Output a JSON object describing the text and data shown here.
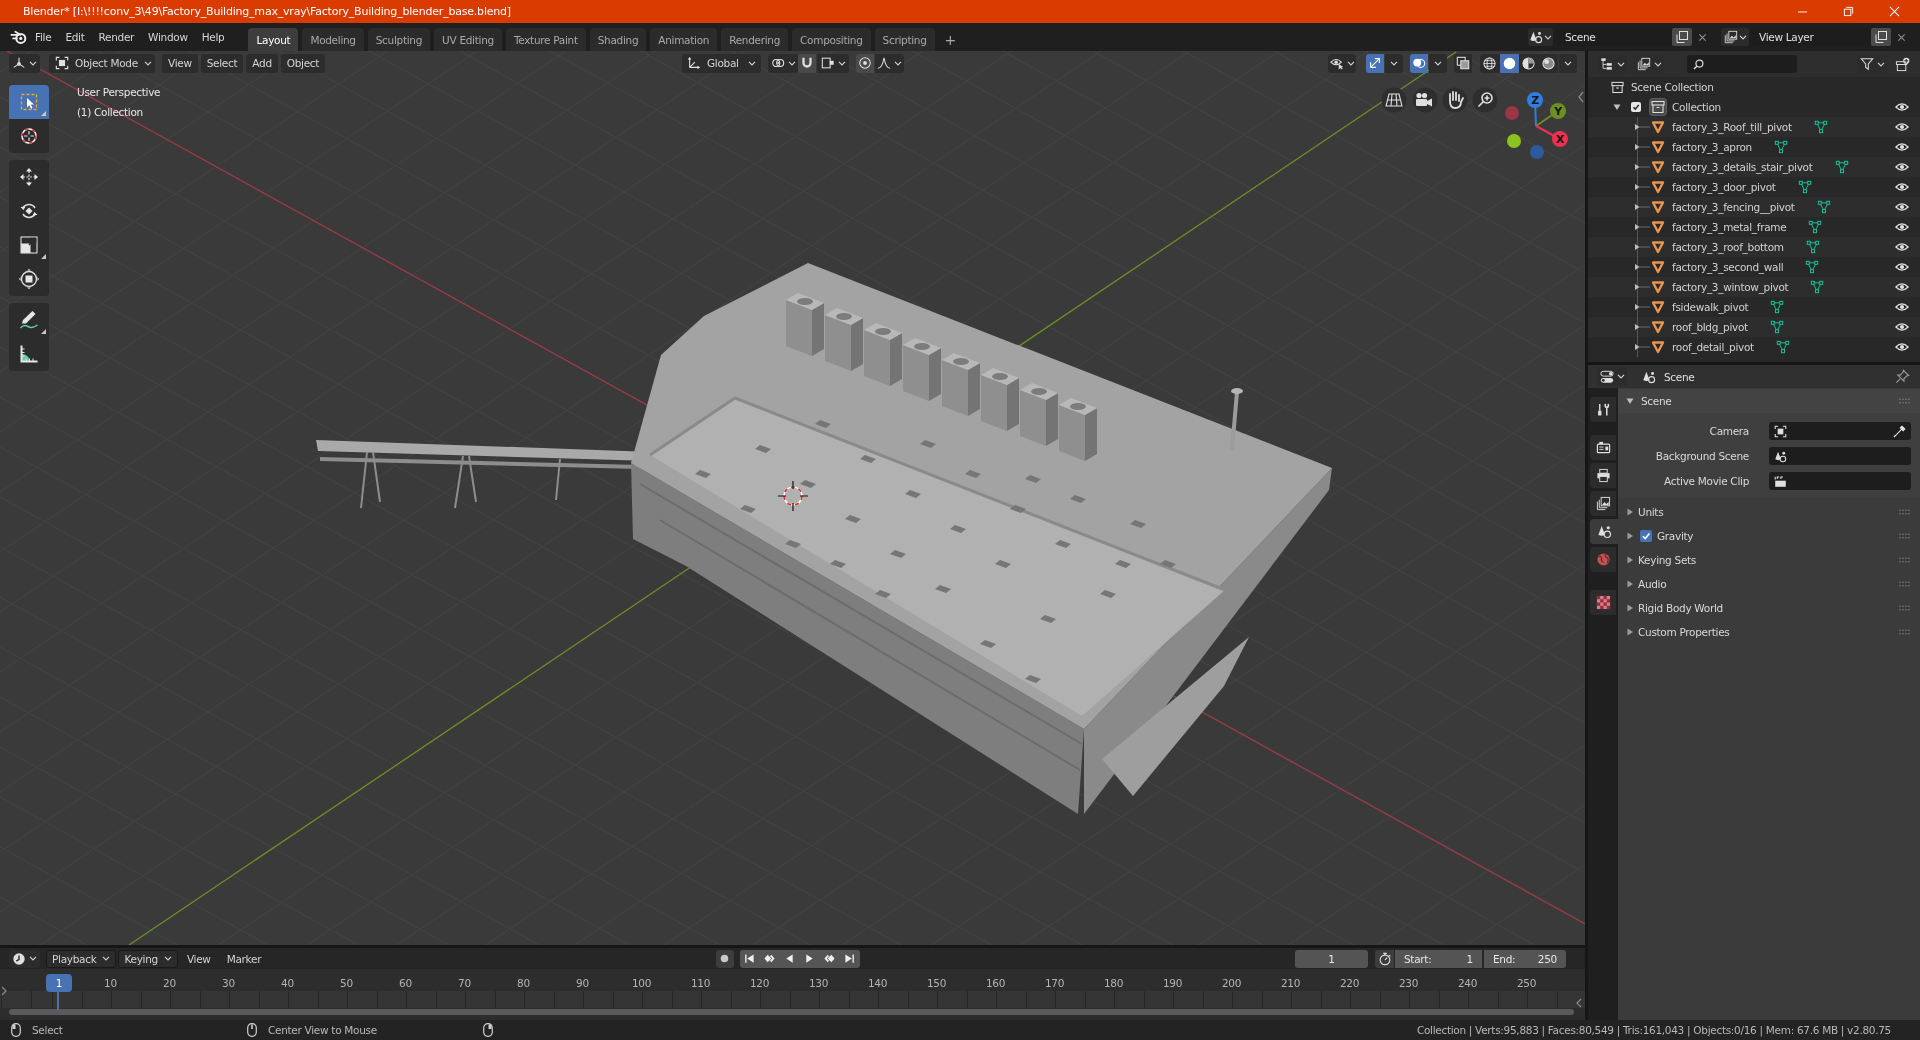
{
  "title_bar": {
    "title": "Blender* [I:\\!!!!conv_3\\49\\Factory_Building_max_vray\\Factory_Building_blender_base.blend]"
  },
  "top_bar": {
    "menus": [
      "File",
      "Edit",
      "Render",
      "Window",
      "Help"
    ],
    "workspaces": [
      {
        "label": "Layout",
        "selected": true
      },
      {
        "label": "Modeling",
        "selected": false
      },
      {
        "label": "Sculpting",
        "selected": false
      },
      {
        "label": "UV Editing",
        "selected": false
      },
      {
        "label": "Texture Paint",
        "selected": false
      },
      {
        "label": "Shading",
        "selected": false
      },
      {
        "label": "Animation",
        "selected": false
      },
      {
        "label": "Rendering",
        "selected": false
      },
      {
        "label": "Compositing",
        "selected": false
      },
      {
        "label": "Scripting",
        "selected": false
      }
    ],
    "add_workspace": "+",
    "scene": "Scene",
    "view_layer": "View Layer"
  },
  "viewport": {
    "header": {
      "mode": "Object Mode",
      "menus": [
        "View",
        "Select",
        "Add",
        "Object"
      ],
      "orientation": "Global",
      "gizmos_on": true,
      "overlays_on": true,
      "xray_on": false,
      "shading": [
        {
          "kind": "wireframe",
          "selected": false
        },
        {
          "kind": "solid",
          "selected": true
        },
        {
          "kind": "material",
          "selected": false
        },
        {
          "kind": "rendered",
          "selected": false
        }
      ]
    },
    "view_name": "User Perspective",
    "collection_info": "(1) Collection",
    "tools": [
      {
        "kind": "select_box",
        "selected": true
      },
      {
        "kind": "cursor",
        "selected": false
      },
      {
        "kind": "move",
        "selected": false
      },
      {
        "kind": "rotate",
        "selected": false
      },
      {
        "kind": "scale",
        "selected": false
      },
      {
        "kind": "transform",
        "selected": false
      },
      {
        "kind": "annotate",
        "selected": false
      },
      {
        "kind": "measure",
        "selected": false
      }
    ],
    "gizmo_axes": [
      {
        "label": "Z",
        "color": "#2f7fe0"
      },
      {
        "label": "Y",
        "color": "#6b8f21"
      },
      {
        "label": "X",
        "color": "#f0304f"
      }
    ]
  },
  "outliner": {
    "root": "Scene Collection",
    "collections": [
      {
        "name": "Collection",
        "expanded": true,
        "checked": true,
        "visible": true,
        "children": [
          {
            "name": "factory_3_Roof_till_pivot",
            "expanded": false,
            "visible": true
          },
          {
            "name": "factory_3_apron",
            "expanded": false,
            "visible": true
          },
          {
            "name": "factory_3_details_stair_pivot",
            "expanded": false,
            "visible": true
          },
          {
            "name": "factory_3_door_pivot",
            "expanded": false,
            "visible": true
          },
          {
            "name": "factory_3_fencing__pivot",
            "expanded": false,
            "visible": true
          },
          {
            "name": "factory_3_metal_frame",
            "expanded": false,
            "visible": true
          },
          {
            "name": "factory_3_roof_bottom",
            "expanded": false,
            "visible": true
          },
          {
            "name": "factory_3_second_wall",
            "expanded": false,
            "visible": true
          },
          {
            "name": "factory_3_wintow_pivot",
            "expanded": false,
            "visible": true
          },
          {
            "name": "fsidewalk_pivot",
            "expanded": false,
            "visible": true
          },
          {
            "name": "roof_bldg_pivot",
            "expanded": false,
            "visible": true
          },
          {
            "name": "roof_detail_pivot",
            "expanded": false,
            "visible": true
          }
        ]
      }
    ]
  },
  "properties": {
    "context": "Scene",
    "tabs": [
      {
        "kind": "tool",
        "selected": false
      },
      {
        "kind": "render",
        "selected": false
      },
      {
        "kind": "output",
        "selected": false
      },
      {
        "kind": "view_layer",
        "selected": false
      },
      {
        "kind": "scene",
        "selected": true
      },
      {
        "kind": "world",
        "selected": false
      },
      {
        "kind": "texture",
        "selected": false
      }
    ],
    "scene_panel": {
      "title": "Scene",
      "expanded": true,
      "fields": [
        {
          "label": "Camera",
          "kind": "camera"
        },
        {
          "label": "Background Scene",
          "kind": "scene"
        },
        {
          "label": "Active Movie Clip",
          "kind": "clip"
        }
      ]
    },
    "panels": [
      {
        "title": "Units",
        "kind": "plain",
        "expanded": false
      },
      {
        "title": "Gravity",
        "kind": "toggle",
        "checked": true,
        "expanded": false
      },
      {
        "title": "Keying Sets",
        "kind": "plain",
        "expanded": false
      },
      {
        "title": "Audio",
        "kind": "plain",
        "expanded": false
      },
      {
        "title": "Rigid Body World",
        "kind": "plain",
        "expanded": false
      },
      {
        "title": "Custom Properties",
        "kind": "plain",
        "expanded": false
      }
    ]
  },
  "timeline": {
    "menus": [
      {
        "label": "Playback",
        "kind": "dropdown"
      },
      {
        "label": "Keying",
        "kind": "dropdown"
      },
      {
        "label": "View",
        "kind": "menu"
      },
      {
        "label": "Marker",
        "kind": "menu"
      }
    ],
    "current_frame": "1",
    "start_label": "Start:",
    "start": "1",
    "end_label": "End:",
    "end": "250",
    "playhead_frame": "1",
    "ruler": [
      "10",
      "20",
      "30",
      "40",
      "50",
      "60",
      "70",
      "80",
      "90",
      "100",
      "110",
      "120",
      "130",
      "140",
      "150",
      "160",
      "170",
      "180",
      "190",
      "200",
      "210",
      "220",
      "230",
      "240",
      "250"
    ]
  },
  "status_bar": {
    "hints": [
      "Select",
      "Center View to Mouse"
    ],
    "stats": "Collection | Verts:95,883 | Faces:80,549 | Tris:161,043 | Objects:0/16 | Mem: 67.6 MB | v2.80.75"
  }
}
